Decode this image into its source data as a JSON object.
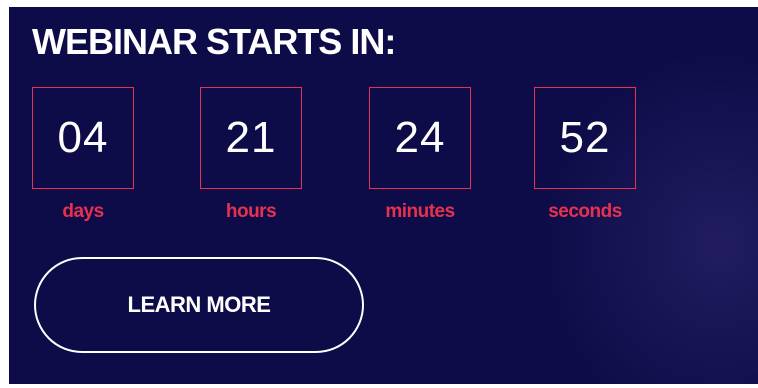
{
  "widget": {
    "title": "WEBINAR STARTS IN:",
    "countdown": [
      {
        "value": "04",
        "label": "days"
      },
      {
        "value": "21",
        "label": "hours"
      },
      {
        "value": "24",
        "label": "minutes"
      },
      {
        "value": "52",
        "label": "seconds"
      }
    ],
    "cta_label": "LEARN MORE"
  },
  "colors": {
    "background": "#0d0c48",
    "accent": "#e8304f",
    "text": "#ffffff"
  }
}
